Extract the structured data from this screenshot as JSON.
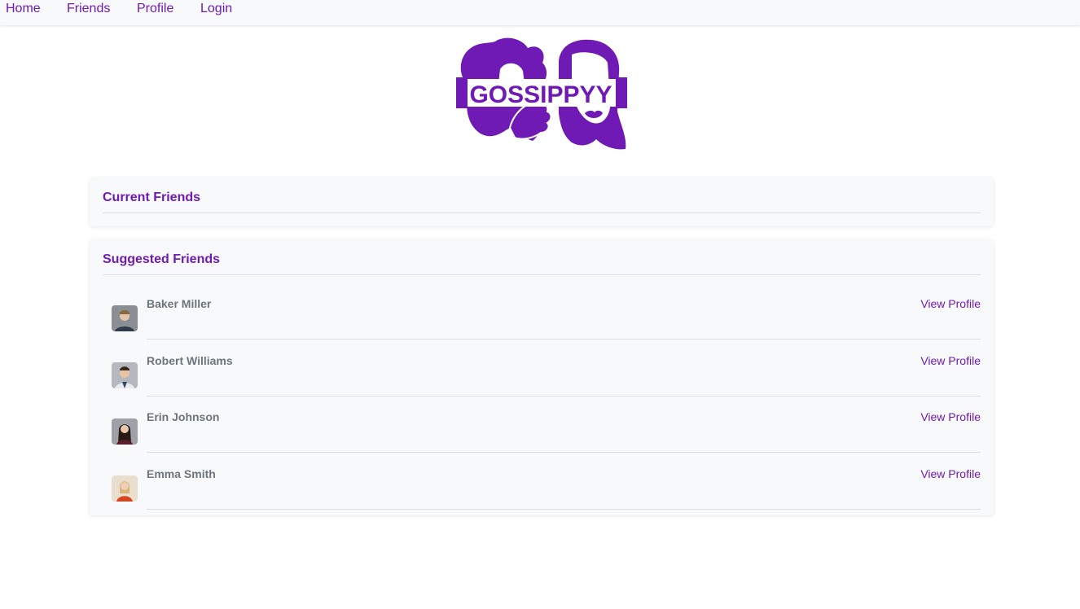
{
  "nav": {
    "items": [
      {
        "label": "Home"
      },
      {
        "label": "Friends"
      },
      {
        "label": "Profile"
      },
      {
        "label": "Login"
      }
    ]
  },
  "brand": {
    "logo_text": "GOSSIPPYY",
    "accent_color": "#6f1ab5"
  },
  "current_friends": {
    "title": "Current Friends",
    "items": []
  },
  "suggested_friends": {
    "title": "Suggested Friends",
    "items": [
      {
        "name": "Baker Miller",
        "action": "View Profile"
      },
      {
        "name": "Robert Williams",
        "action": "View Profile"
      },
      {
        "name": "Erin Johnson",
        "action": "View Profile"
      },
      {
        "name": "Emma Smith",
        "action": "View Profile"
      }
    ]
  }
}
